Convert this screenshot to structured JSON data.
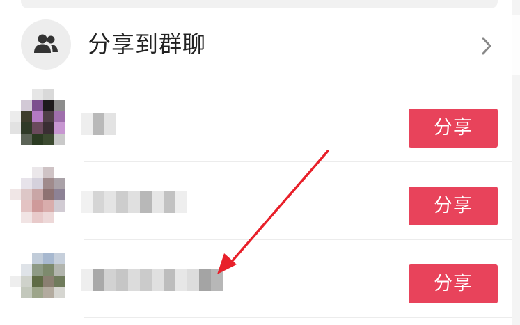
{
  "group_share": {
    "title": "分享到群聊",
    "icon": "group-people-icon",
    "chevron_icon": "chevron-right-icon"
  },
  "contacts": [
    {
      "share_label": "分享"
    },
    {
      "share_label": "分享"
    },
    {
      "share_label": "分享"
    }
  ],
  "colors": {
    "share_button": "#e8435b",
    "annotation_arrow": "#e8202a",
    "divider": "#ececec"
  }
}
